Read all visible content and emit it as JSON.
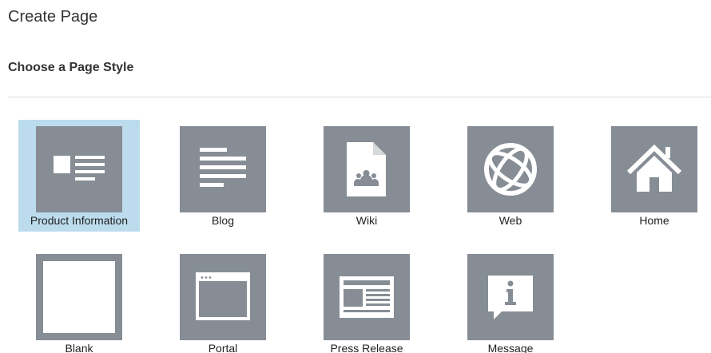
{
  "header": {
    "title": "Create Page",
    "subtitle": "Choose a Page Style"
  },
  "styles": [
    {
      "label": "Product Information",
      "icon": "product-information-icon",
      "selected": true
    },
    {
      "label": "Blog",
      "icon": "blog-icon",
      "selected": false
    },
    {
      "label": "Wiki",
      "icon": "wiki-icon",
      "selected": false
    },
    {
      "label": "Web",
      "icon": "web-icon",
      "selected": false
    },
    {
      "label": "Home",
      "icon": "home-icon",
      "selected": false
    },
    {
      "label": "Blank",
      "icon": "blank-icon",
      "selected": false
    },
    {
      "label": "Portal",
      "icon": "portal-icon",
      "selected": false
    },
    {
      "label": "Press Release",
      "icon": "press-release-icon",
      "selected": false
    },
    {
      "label": "Message",
      "icon": "message-icon",
      "selected": false
    }
  ],
  "colors": {
    "tile_background": "#868d95",
    "selected_background": "#bcdcee",
    "icon_foreground": "#ffffff"
  }
}
